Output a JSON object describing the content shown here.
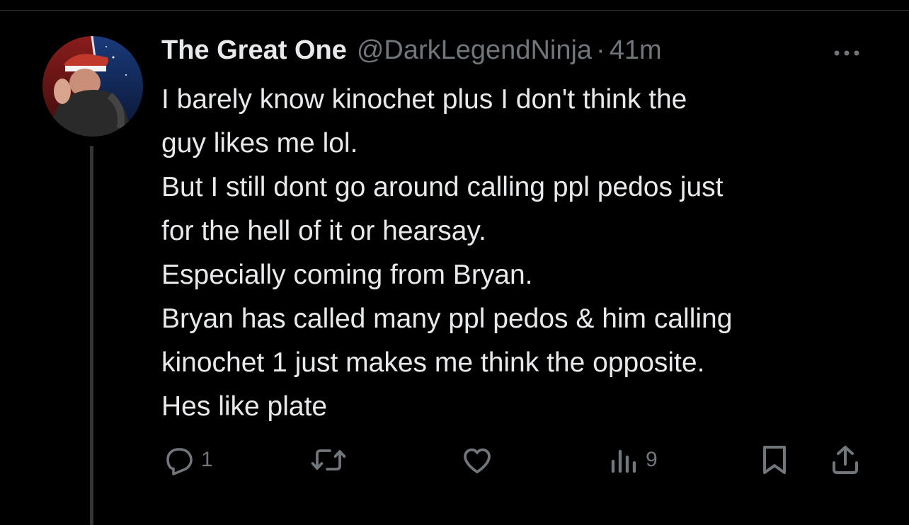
{
  "tweet": {
    "author_name": "The Great One",
    "author_handle": "@DarkLegendNinja",
    "separator": "·",
    "timestamp": "41m",
    "lines": [
      "I barely know kinochet plus I don't think the",
      "guy likes me lol.",
      "But I still dont go around calling ppl pedos just",
      "for the hell of it or hearsay.",
      "Especially coming from Bryan.",
      "Bryan has called many ppl pedos & him calling",
      "kinochet 1 just makes me think the opposite.",
      "Hes like plate"
    ]
  },
  "actions": {
    "reply_count": "1",
    "views_count": "9",
    "icons": [
      "reply-icon",
      "retweet-icon",
      "like-icon",
      "views-icon",
      "bookmark-icon",
      "share-icon"
    ]
  },
  "colors": {
    "background": "#000000",
    "text_primary": "#e7e9ea",
    "text_secondary": "#71767b",
    "thread_line": "#333639"
  }
}
